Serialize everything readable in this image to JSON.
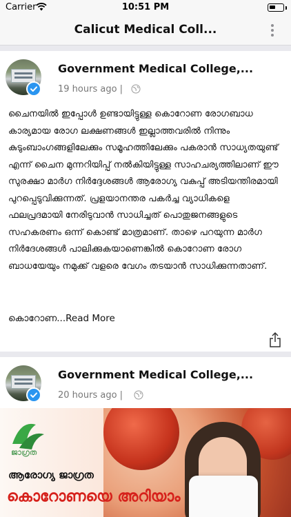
{
  "status_bar": {
    "carrier": "Carrier",
    "time": "10:51 PM",
    "wifi_icon": "wifi-icon",
    "battery_icon": "battery-icon"
  },
  "nav": {
    "title": "Calicut Medical Coll...",
    "more_icon": "more-vertical-icon"
  },
  "posts": [
    {
      "author": "Government Medical College,...",
      "time": "19 hours ago |",
      "privacy_icon": "globe-icon",
      "verified_icon": "verified-check-icon",
      "body": "ചൈനയിൽ ഇപ്പോൾ ഉണ്ടായിട്ടുള്ള കൊറോണ രോഗബാധ കാര്യമായ രോഗ ലക്ഷണങ്ങൾ ഇല്ലാത്തവരിൽ നിന്നും കുടുംബാംഗങ്ങളിലേക്കും സമൂഹത്തിലേക്കും പകരാൻ സാധ്യതയുണ്ട് എന്ന് ചൈന മുന്നറിയിപ്പ് നൽകിയിട്ടുള്ള സാഹചര്യത്തിലാണ് ഈ സുരക്ഷാ മാർഗ നിർദ്ദേശങ്ങൾ ആരോഗ്യ വകുപ്പ് അടിയന്തിരമായി പുറപ്പെടുവിക്കുന്നത്. പ്രളയാനന്തര പകർച്ച വ്യാധികളെ ഫലപ്രദമായി നേരിടുവാൻ സാധിച്ചത് പൊതുജനങ്ങളുടെ സഹകരണം ഒന്ന് കൊണ്ട് മാത്രമാണ്. താഴെ പറയുന്ന മാർഗ നിർദേശങ്ങൾ പാലിക്കുകയാണെങ്കിൽ കൊറോണ രോഗ ബാധയേയും നമുക്ക് വളരെ വേഗം തടയാൻ സാധിക്കുന്നതാണ്.",
      "excerpt_tail": "കൊറോണ...",
      "read_more": "Read More",
      "share_icon": "share-icon"
    },
    {
      "author": "Government Medical College,...",
      "time": "20 hours ago |",
      "privacy_icon": "globe-icon",
      "verified_icon": "verified-check-icon",
      "image": {
        "brand_text": "ജാഗ്രത",
        "subtitle": "ആരോഗ്യ ജാഗ്രത",
        "title": "കൊറോണയെ അറിയാം"
      }
    }
  ],
  "colors": {
    "accent_blue": "#2a95f0",
    "banner_red": "#d6211b"
  }
}
